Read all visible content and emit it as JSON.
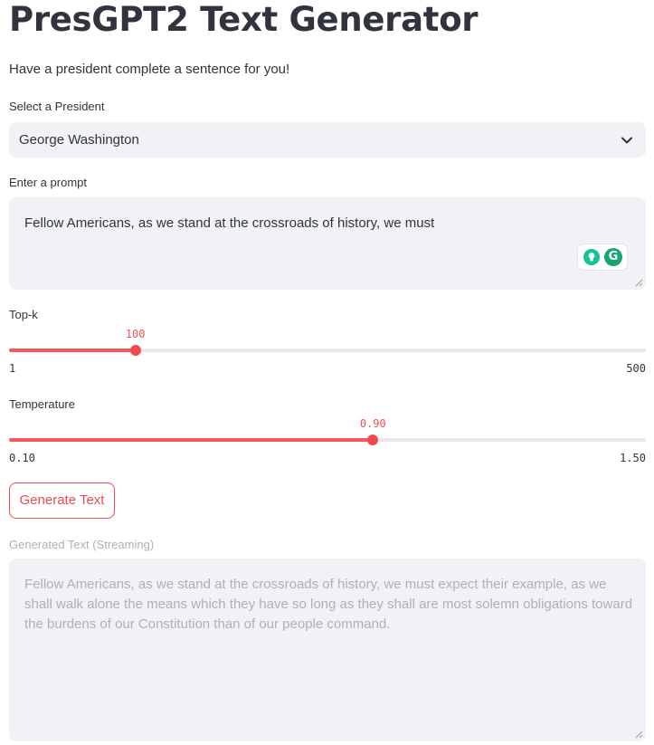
{
  "page": {
    "title": "PresGPT2 Text Generator",
    "subtitle": "Have a president complete a sentence for you!"
  },
  "president_select": {
    "label": "Select a President",
    "selected_value": "George Washington",
    "icon": "chevron-down-icon"
  },
  "prompt": {
    "label": "Enter a prompt",
    "value": "Fellow Americans, as we stand at the crossroads of history, we must",
    "extension_icons": [
      "grammarly-suggestion-icon",
      "grammarly-logo-icon"
    ]
  },
  "top_k": {
    "label": "Top-k",
    "value": 100,
    "value_label": "100",
    "min": 1,
    "max": 500,
    "min_label": "1",
    "max_label": "500"
  },
  "temperature": {
    "label": "Temperature",
    "value": 0.9,
    "value_label": "0.90",
    "min": 0.1,
    "max": 1.5,
    "min_label": "0.10",
    "max_label": "1.50"
  },
  "generate_button": {
    "label": "Generate Text"
  },
  "output": {
    "label": "Generated Text (Streaming)",
    "value": "Fellow Americans, as we stand at the crossroads of history, we must expect their example, as we shall walk alone the means which they have so long as they shall are most solemn obligations toward the burdens of our Constitution than of our people command."
  },
  "colors": {
    "accent": "#f04a4e",
    "input_background": "#f0f2f6",
    "text": "#31333f",
    "muted_text": "#aeb0b7"
  }
}
